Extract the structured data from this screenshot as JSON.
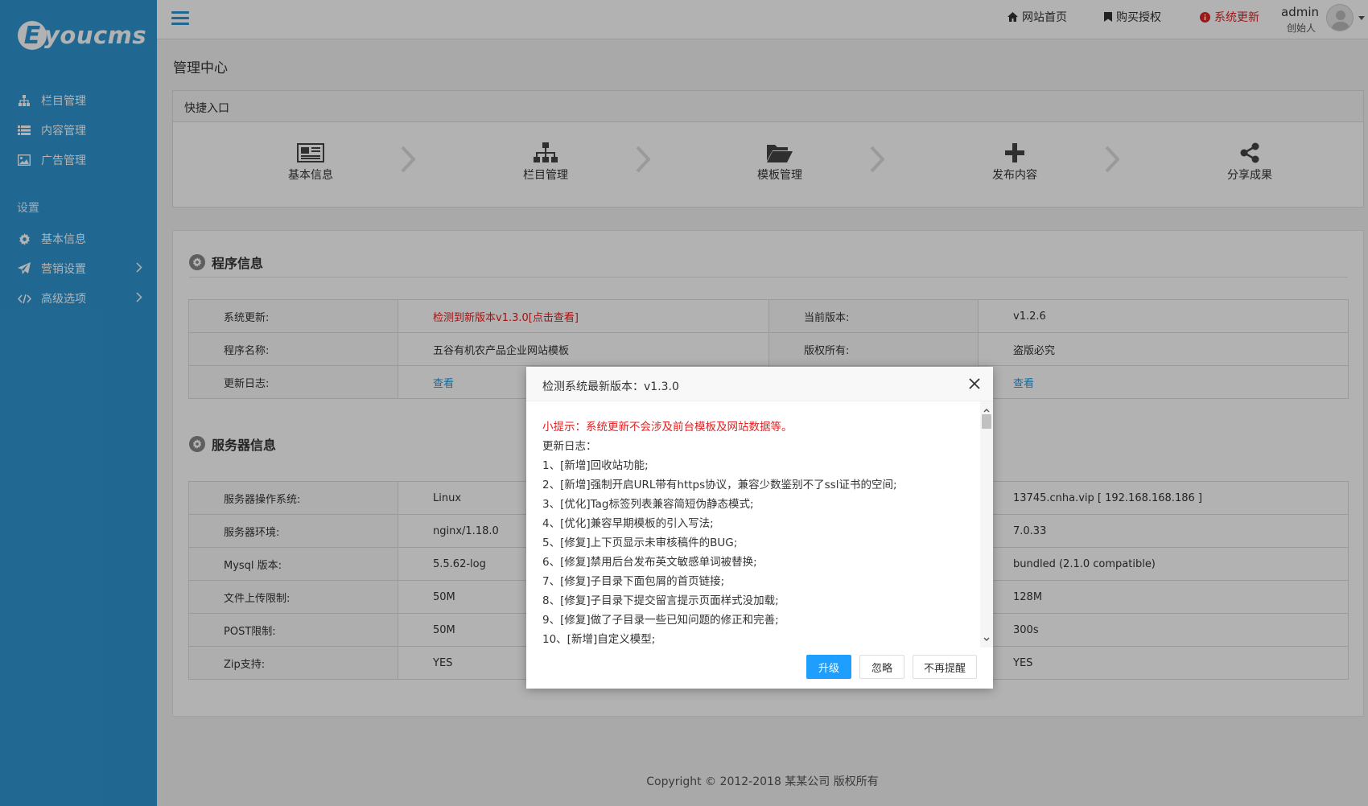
{
  "brand": {
    "logo_letter": "E",
    "logo_text": "youcms"
  },
  "sidebar": {
    "items": [
      {
        "label": "栏目管理",
        "icon": "sitemap-icon"
      },
      {
        "label": "内容管理",
        "icon": "list-icon"
      },
      {
        "label": "广告管理",
        "icon": "image-icon"
      }
    ],
    "group_label": "设置",
    "settings_items": [
      {
        "label": "基本信息",
        "icon": "gear-icon"
      },
      {
        "label": "营销设置",
        "icon": "paper-plane-icon"
      },
      {
        "label": "高级选项",
        "icon": "code-icon"
      }
    ]
  },
  "topbar": {
    "home_link": "网站首页",
    "buy_link": "购买授权",
    "update_link": "系统更新",
    "user_name": "admin",
    "user_role": "创始人"
  },
  "page": {
    "title": "管理中心"
  },
  "quick": {
    "title": "快捷入口",
    "items": [
      {
        "label": "基本信息",
        "icon": "newspaper-icon"
      },
      {
        "label": "栏目管理",
        "icon": "sitemap-icon"
      },
      {
        "label": "模板管理",
        "icon": "folder-open-icon"
      },
      {
        "label": "发布内容",
        "icon": "plus-icon"
      },
      {
        "label": "分享成果",
        "icon": "share-icon"
      }
    ]
  },
  "program": {
    "title": "程序信息",
    "rows": [
      {
        "k1": "系统更新:",
        "v1": "检测到新版本v1.3.0[点击查看]",
        "k2": "当前版本:",
        "v2": "v1.2.6"
      },
      {
        "k1": "程序名称:",
        "v1": "五谷有机农产品企业网站模板",
        "k2": "版权所有:",
        "v2": "盗版必究"
      },
      {
        "k1": "更新日志:",
        "v1": "查看",
        "k2": "",
        "v2": "查看"
      }
    ]
  },
  "server": {
    "title": "服务器信息",
    "rows": [
      {
        "k1": "服务器操作系统:",
        "v1": "Linux",
        "k2": "",
        "v2": "13745.cnha.vip [ 192.168.168.186 ]"
      },
      {
        "k1": "服务器环境:",
        "v1": "nginx/1.18.0",
        "k2": "",
        "v2": "7.0.33"
      },
      {
        "k1": "Mysql 版本:",
        "v1": "5.5.62-log",
        "k2": "",
        "v2": "bundled (2.1.0 compatible)"
      },
      {
        "k1": "文件上传限制:",
        "v1": "50M",
        "k2": "",
        "v2": "128M"
      },
      {
        "k1": "POST限制:",
        "v1": "50M",
        "k2": "",
        "v2": "300s"
      },
      {
        "k1": "Zip支持:",
        "v1": "YES",
        "k2": "",
        "v2": "YES"
      }
    ]
  },
  "footer": {
    "text": "Copyright © 2012-2018 某某公司 版权所有"
  },
  "dialog": {
    "title": "检测系统最新版本：v1.3.0",
    "tip": "小提示：系统更新不会涉及前台模板及网站数据等。",
    "log_title": "更新日志：",
    "lines": [
      "1、[新增]回收站功能;",
      "2、[新增]强制开启URL带有https协议，兼容少数鉴别不了ssl证书的空间;",
      "3、[优化]Tag标签列表兼容简短伪静态模式;",
      "4、[优化]兼容早期模板的引入写法;",
      "5、[修复]上下页显示未审核稿件的BUG;",
      "6、[修复]禁用后台发布英文敏感单词被替换;",
      "7、[修复]子目录下面包屑的首页链接;",
      "8、[修复]子目录下提交留言提示页面样式没加载;",
      "9、[修复]做了子目录一些已知问题的修正和完善;",
      "10、[新增]自定义模型;"
    ],
    "btn_upgrade": "升级",
    "btn_ignore": "忽略",
    "btn_never": "不再提醒"
  },
  "colors": {
    "sidebar": "#2f96d2",
    "alert_red": "#e02222",
    "primary_button": "#1e9fff"
  }
}
